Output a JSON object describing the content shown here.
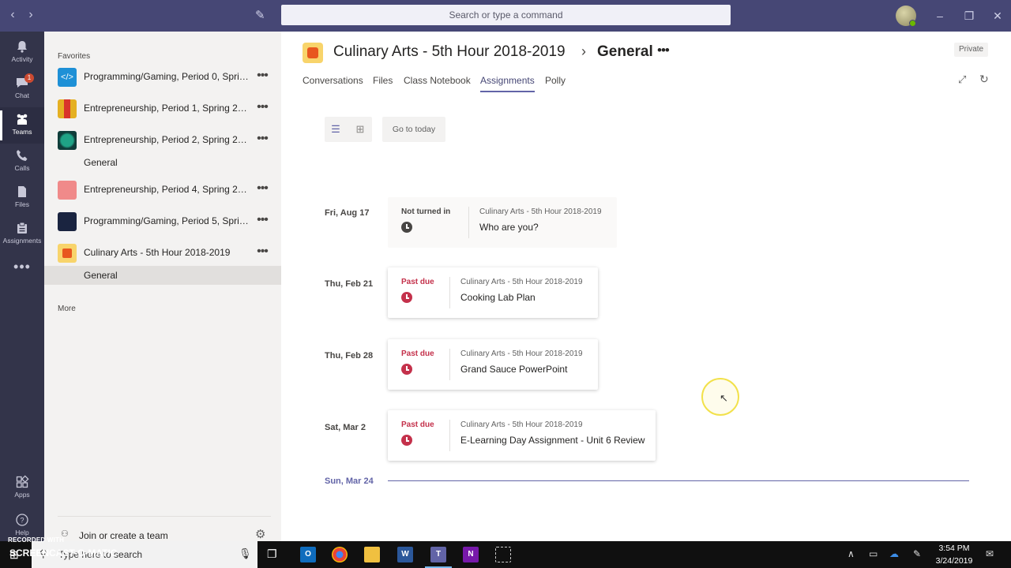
{
  "titlebar": {
    "search_placeholder": "Search or type a command"
  },
  "appbar": {
    "items": [
      {
        "label": "Activity",
        "icon": "bell-icon"
      },
      {
        "label": "Chat",
        "icon": "chat-icon",
        "badge": "1"
      },
      {
        "label": "Teams",
        "icon": "teams-icon"
      },
      {
        "label": "Calls",
        "icon": "phone-icon"
      },
      {
        "label": "Files",
        "icon": "files-icon"
      },
      {
        "label": "Assignments",
        "icon": "assignments-icon"
      }
    ],
    "apps_label": "Apps",
    "help_label": "Help"
  },
  "teamlist": {
    "favorites_label": "Favorites",
    "more_label": "More",
    "teams": [
      {
        "name": "Programming/Gaming, Period 0, Spring 2019",
        "tile_color": "#1e90d6"
      },
      {
        "name": "Entrepreneurship, Period 1, Spring 2019",
        "tile_color": "#e5b022"
      },
      {
        "name": "Entrepreneurship, Period 2, Spring 2019",
        "tile_color": "#0f5a55"
      },
      {
        "name": "Entrepreneurship, Period 4, Spring 2019",
        "tile_color": "#f08a8a"
      },
      {
        "name": "Programming/Gaming, Period 5, Spring 2019",
        "tile_color": "#1a2440"
      },
      {
        "name": "Culinary Arts - 5th Hour 2018-2019",
        "tile_color": "#f8d46b"
      }
    ],
    "channels": {
      "team3_general": "General",
      "culinary_general": "General"
    },
    "join_label": "Join or create a team"
  },
  "main": {
    "team_name": "Culinary Arts - 5th Hour 2018-2019",
    "channel_name": "General",
    "private_label": "Private",
    "tabs": [
      "Conversations",
      "Files",
      "Class Notebook",
      "Assignments",
      "Polly"
    ],
    "active_tab": "Assignments",
    "today_button": "Go to today",
    "assignments": [
      {
        "date": "Fri, Aug 17",
        "status": "Not turned in",
        "team": "Culinary Arts - 5th Hour 2018-2019",
        "title": "Who are you?"
      },
      {
        "date": "Thu, Feb 21",
        "status": "Past due",
        "team": "Culinary Arts - 5th Hour 2018-2019",
        "title": "Cooking Lab Plan"
      },
      {
        "date": "Thu, Feb 28",
        "status": "Past due",
        "team": "Culinary Arts - 5th Hour 2018-2019",
        "title": "Grand Sauce PowerPoint"
      },
      {
        "date": "Sat, Mar 2",
        "status": "Past due",
        "team": "Culinary Arts - 5th Hour 2018-2019",
        "title": "E-Learning Day Assignment - Unit 6 Review"
      }
    ],
    "today_label": "Sun, Mar 24"
  },
  "taskbar": {
    "search_text": "Type here to search",
    "time": "3:54 PM",
    "date": "3/24/2019",
    "watermark_top": "RECORDED WITH",
    "watermark_brand": "SCREENCAST-O-MATIC"
  },
  "colors": {
    "titlebar": "#464775",
    "appbar": "#33344a",
    "accent": "#6264a7",
    "past_due": "#c4314b"
  }
}
